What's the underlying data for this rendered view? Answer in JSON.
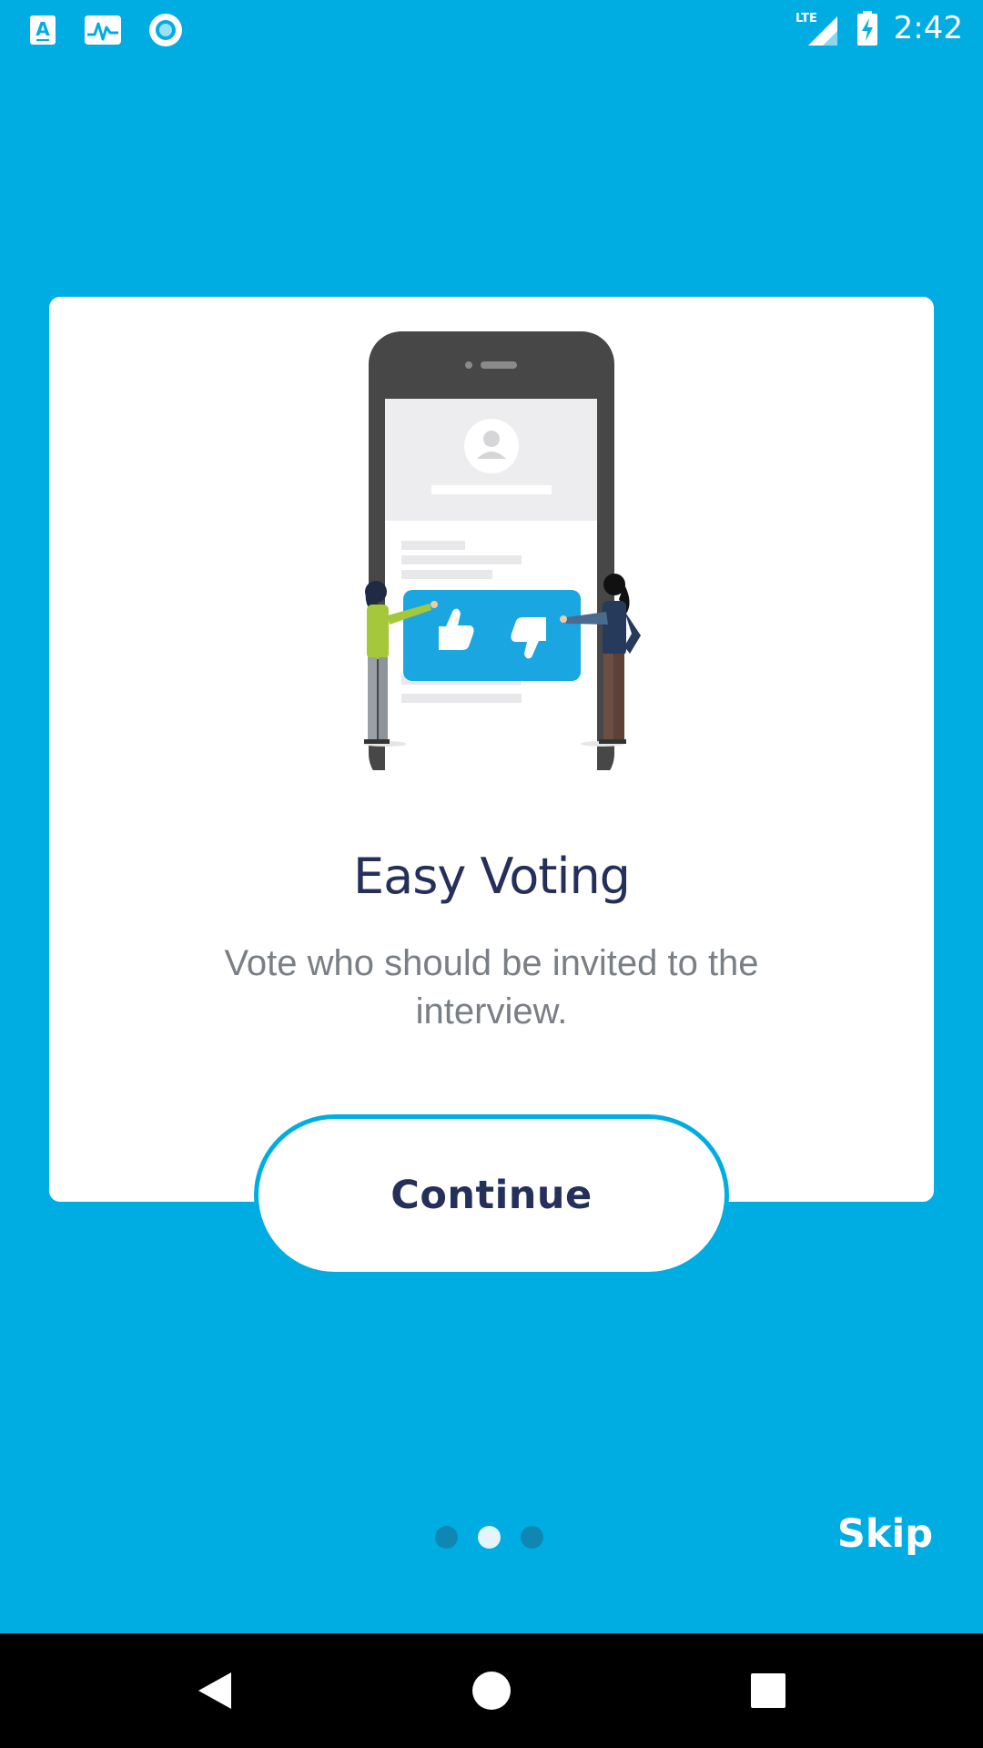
{
  "status_bar": {
    "time": "2:42",
    "network_label": "LTE",
    "left_icons": [
      "font-app-icon",
      "activity-icon",
      "circle-app-icon"
    ],
    "right_icons": [
      "lte-signal-icon",
      "battery-charging-icon"
    ]
  },
  "onboarding": {
    "title": "Easy Voting",
    "description": "Vote who should be invited to the interview.",
    "illustration": "phone-voting-illustration",
    "continue_label": "Continue",
    "skip_label": "Skip",
    "pager": {
      "total": 3,
      "active_index": 1
    }
  },
  "nav_bar": {
    "buttons": [
      "back-icon",
      "home-icon",
      "recents-icon"
    ]
  },
  "colors": {
    "background": "#00ADE3",
    "card": "#FFFFFF",
    "title": "#25305A",
    "description": "#7A7F85",
    "dot_inactive": "#0E88B2",
    "dot_active": "#E3F5FB"
  }
}
